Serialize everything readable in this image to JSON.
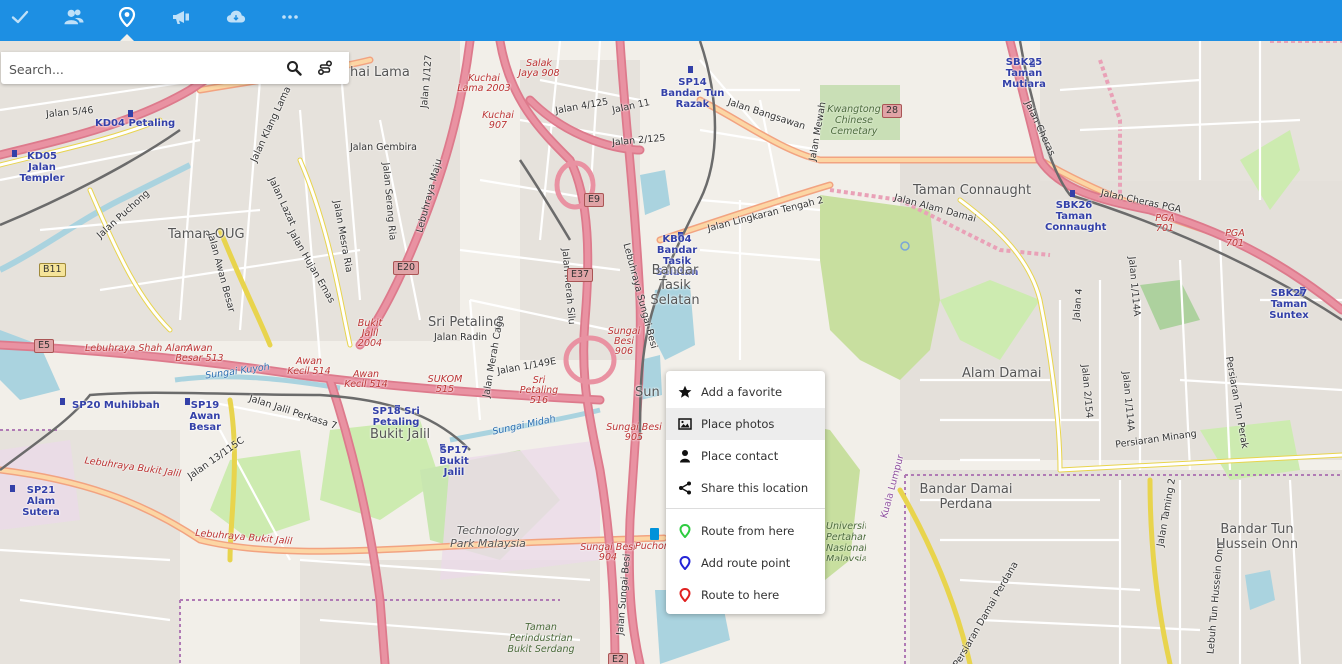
{
  "topbar": {
    "apps": [
      {
        "icon": "checkmark-icon"
      },
      {
        "icon": "contacts-icon"
      },
      {
        "icon": "maps-pin-icon",
        "active": true
      },
      {
        "icon": "announcement-icon"
      },
      {
        "icon": "cloud-weather-icon"
      },
      {
        "icon": "more-dots-icon"
      }
    ]
  },
  "search": {
    "placeholder": "Search...",
    "value": "",
    "search_icon": "search-icon",
    "route_icon": "route-icon"
  },
  "context_menu": {
    "items": [
      {
        "label": "Add a favorite",
        "icon": "star-icon"
      },
      {
        "label": "Place photos",
        "icon": "image-icon"
      },
      {
        "label": "Place contact",
        "icon": "person-icon"
      },
      {
        "label": "Share this location",
        "icon": "share-icon"
      },
      {
        "label": "Route from here",
        "icon": "green-pin-icon"
      },
      {
        "label": "Add route point",
        "icon": "blue-pin-icon"
      },
      {
        "label": "Route to here",
        "icon": "red-pin-icon"
      }
    ]
  },
  "map": {
    "stations": [
      "KD04 Petaling",
      "KD05 Jalan Templer",
      "SP14 Bandar Tun Razak",
      "SBK25 Taman Mutiara",
      "SBK26 Taman Connaught",
      "KB04 Bandar Tasik Selatan",
      "SBK27 Taman Suntex",
      "SP20 Muhibbah",
      "SP19 Awan Besar",
      "SP18 Sri Petaling",
      "SP17 Bukit Jalil",
      "SP21 Alam Sutera"
    ],
    "areas": [
      "hai Lama",
      "Taman OUG",
      "Sri Petaling",
      "Bandar Tasik Selatan",
      "Taman Connaught",
      "Alam Damai",
      "Bukit Jalil",
      "Bandar Damai Perdana",
      "Bandar Tun Hussein Onn",
      "Technology Park Malaysia",
      "Sun"
    ],
    "streets": [
      "Jalan 5/46",
      "Jalan Puchong",
      "Jalan Klang Lama",
      "Jalan Gembira",
      "Jalan Lazat",
      "Jalan Serang Ria",
      "Jalan Mesra Ria",
      "Jalan Hujan Emas",
      "Jalan Awan Besar",
      "Jalan Radin",
      "Jalan 1/149E",
      "Jalan Merah Caga",
      "Jalan Merah Silu",
      "Jalan Jalil Perkasa 7",
      "Jalan 13/115C",
      "Jalan 4/125",
      "Jalan 11",
      "Jalan 2/125",
      "Jalan Bangsawan",
      "Jalan Mewah",
      "Jalan Lingkaran Tengah 2",
      "Jalan Alam Damai",
      "Jalan Cheras",
      "Jalan Cheras PGA",
      "Jalan 4",
      "Jalan 1/114A",
      "Jalan 2/154",
      "Jalan 1/114A",
      "Persiaran Minang",
      "Persiaran Tun Perak",
      "Jalan Taming 2",
      "Lebuh Tun Hussein Onn",
      "Persiaran Damai Perdana",
      "Jalan 1/127",
      "Jalan Sungai Besi",
      "Kuala Lumpur"
    ],
    "highways": [
      "Lebuhraya Shah Alam",
      "Awan Besar 513",
      "Awan Kecil 514",
      "Awan Kecil 514",
      "SUKOM 515",
      "Sri Petaling 516",
      "Bukit Jalil 2004",
      "Lebuhraya Bukit Jalil",
      "Lebuhraya Bukit Jalil",
      "Salak Jaya 908",
      "Kuchai Lama 2003",
      "Kuchai 907",
      "Sungai Besi 906",
      "Sungai Besi 905",
      "Sungai Besi 904",
      "Lebuhraya Sungai Besi",
      "Lebuhraya Maju",
      "Sungai Kuyoh",
      "Sungai Midah"
    ],
    "shields": [
      "E20",
      "E37",
      "E9",
      "E5",
      "B11",
      "28",
      "E2"
    ],
    "parks": [
      "Kwangtong Chinese Cemetary",
      "Taman Perindustrian Bukit Serdang",
      "Universiti Pertahanan Nasional Malaysia"
    ],
    "other": [
      "PGA 701",
      "PGA 701",
      "Puchong"
    ]
  },
  "colors": {
    "topbar": "#1d8fe3",
    "motorway": "#e990a0",
    "trunk": "#f9b29c",
    "primary": "#fcd6a4",
    "secondary": "#f7fabf",
    "park": "#cdebb0",
    "rail": "#707070",
    "station_text": "#3340a8"
  }
}
